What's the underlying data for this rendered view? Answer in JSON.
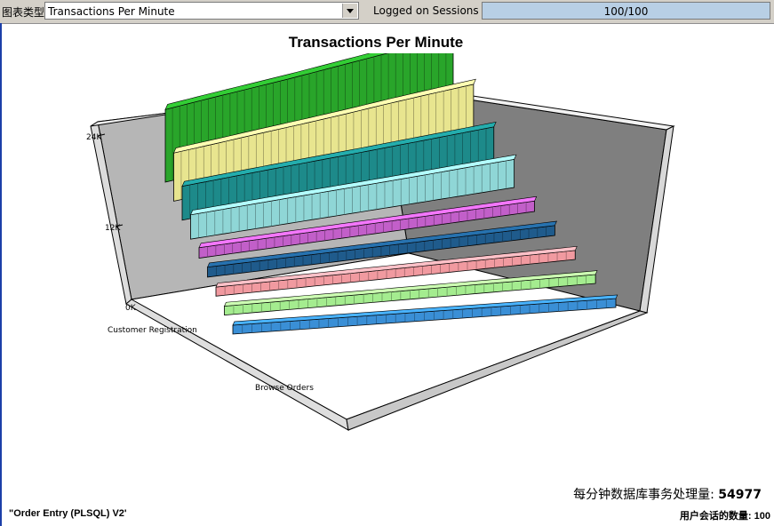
{
  "toolbar": {
    "chart_type_label": "图表类型",
    "chart_type_value": "Transactions Per Minute",
    "sessions_label": "Logged on Sessions",
    "sessions_value": "100/100",
    "sessions_fraction": 1.0
  },
  "chart_data": {
    "type": "bar",
    "title": "Transactions Per Minute",
    "y_ticks": [
      "24K",
      "12K",
      "0K"
    ],
    "ylim": [
      0,
      24000
    ],
    "category_labels": [
      "Customer Registration",
      "Browse Orders"
    ],
    "series": [
      {
        "color": "#29a52a",
        "values": [
          21500,
          21800,
          22000,
          22200,
          22600,
          23000,
          23400,
          23800
        ]
      },
      {
        "color": "#e8e58f",
        "values": [
          15000,
          15300,
          15700,
          16000,
          16400,
          17000,
          17400,
          17700
        ]
      },
      {
        "color": "#1d8a8a",
        "values": [
          11000,
          11200,
          11400,
          11500,
          11600,
          11800,
          12000,
          12200
        ]
      },
      {
        "color": "#8fd6d6",
        "values": [
          8000,
          8300,
          8600,
          8800,
          9000,
          9300,
          9700,
          10000
        ]
      },
      {
        "color": "#c25fc9",
        "values": [
          1000,
          1000,
          1000,
          1000,
          1000,
          1000,
          1000,
          1000
        ]
      },
      {
        "color": "#1f5b8c",
        "values": [
          900,
          900,
          900,
          900,
          900,
          900,
          900,
          900
        ]
      },
      {
        "color": "#f19aa0",
        "values": [
          150,
          150,
          150,
          150,
          150,
          150,
          150,
          150
        ]
      },
      {
        "color": "#a4ec8f",
        "values": [
          150,
          150,
          150,
          150,
          150,
          150,
          150,
          150
        ]
      },
      {
        "color": "#3a8fd6",
        "values": [
          150,
          150,
          150,
          150,
          150,
          150,
          150,
          150
        ]
      }
    ]
  },
  "status": {
    "tpm_label": "每分钟数据库事务处理量: ",
    "tpm_value": "54977",
    "workload_name": "\"Order Entry (PLSQL) V2'",
    "sessions_label": "用户会话的数量: ",
    "sessions_value": "100"
  }
}
